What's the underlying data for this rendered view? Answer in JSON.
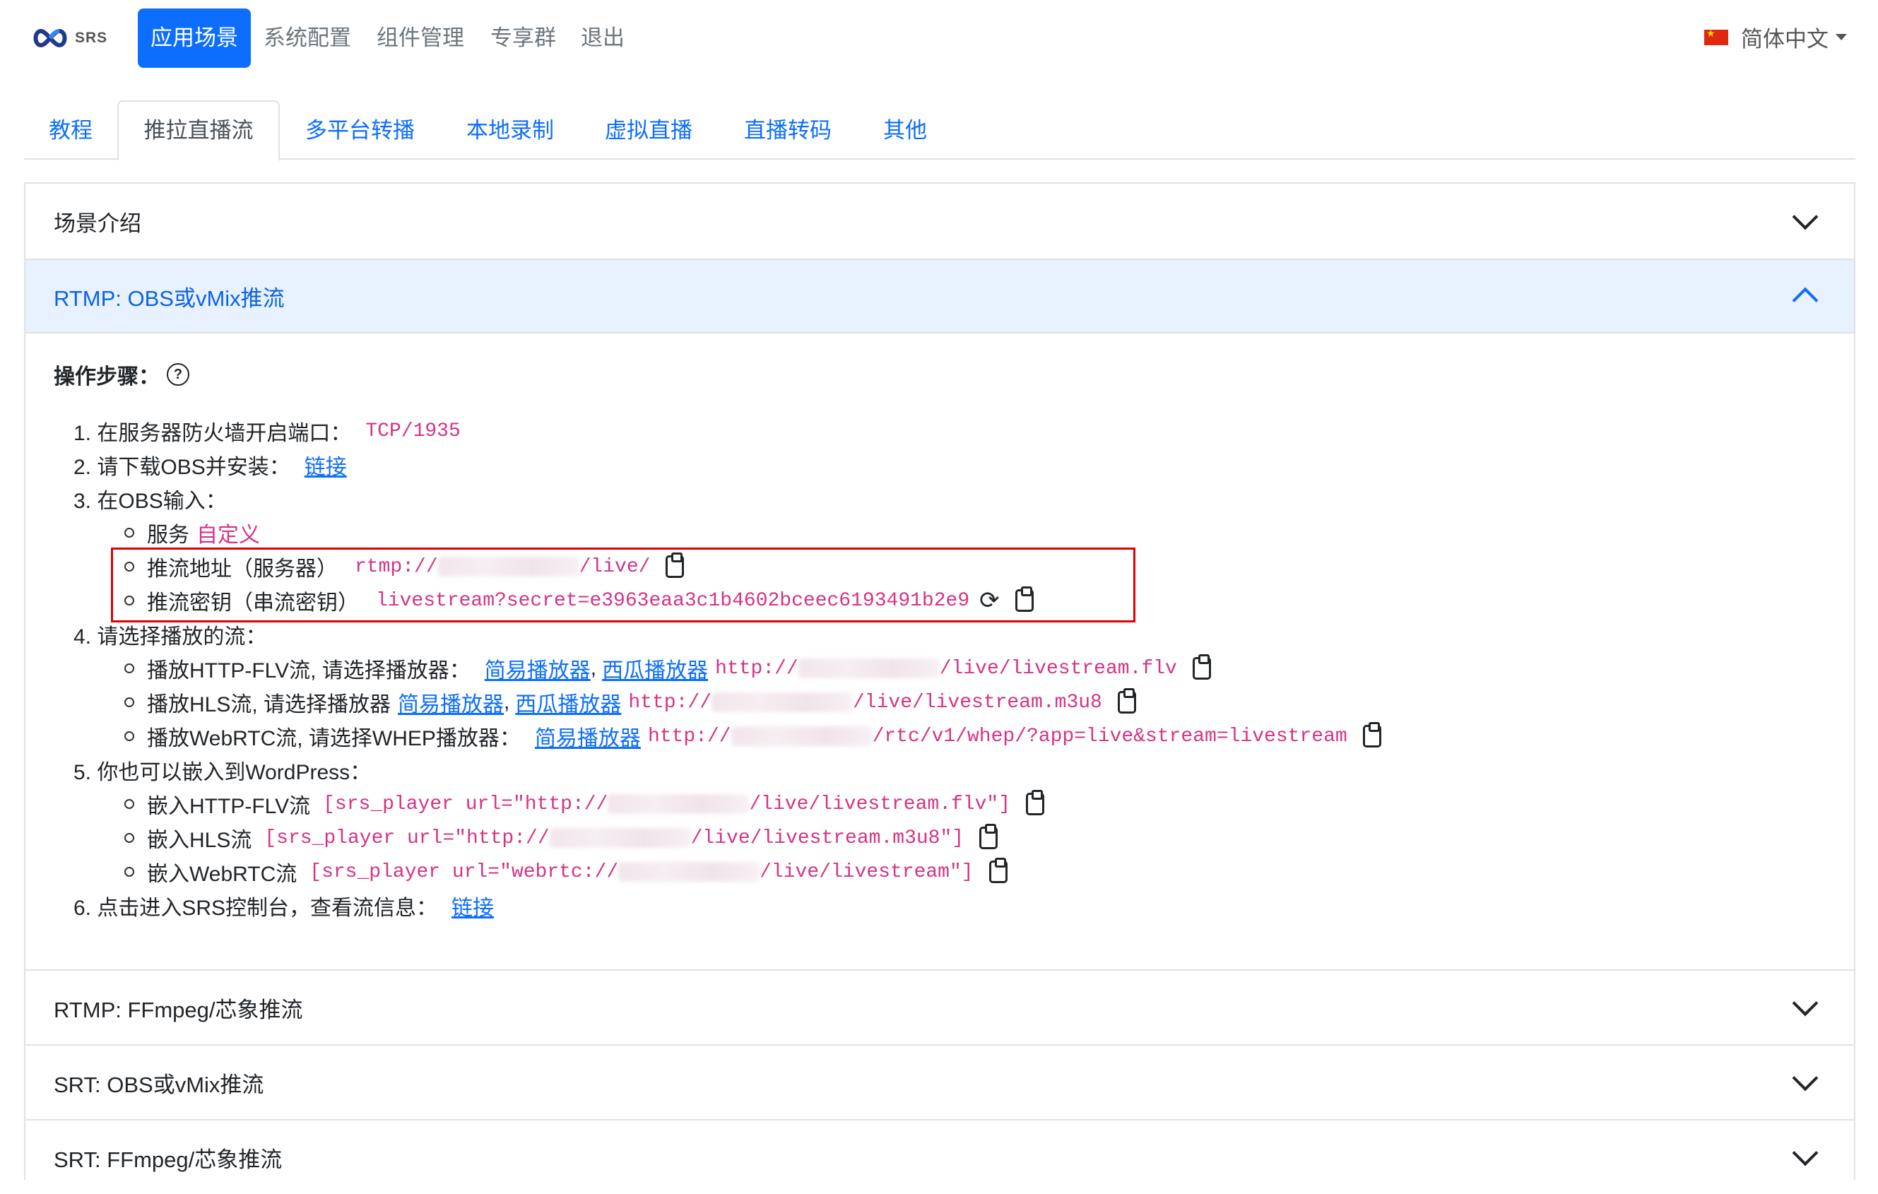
{
  "brand": {
    "logo_text": "SRS"
  },
  "nav": {
    "items": [
      "应用场景",
      "系统配置",
      "组件管理",
      "专享群",
      "退出"
    ],
    "language": "简体中文"
  },
  "tabs": [
    "教程",
    "推拉直播流",
    "多平台转播",
    "本地录制",
    "虚拟直播",
    "直播转码",
    "其他"
  ],
  "accordion": {
    "intro_title": "场景介绍",
    "open_title": "RTMP: OBS或vMix推流",
    "collapsed": [
      "RTMP: FFmpeg/芯象推流",
      "SRT: OBS或vMix推流",
      "SRT: FFmpeg/芯象推流"
    ]
  },
  "steps": {
    "heading": "操作步骤：",
    "help_icon": "?",
    "s1_label": "1. 在服务器防火墙开启端口：",
    "s1_value": "TCP/1935",
    "s2_label": "2. 请下载OBS并安装：",
    "s2_link": "链接",
    "s3_label": "3. 在OBS输入：",
    "s3_service_label": "服务",
    "s3_service_value": "自定义",
    "s3_server_label": "推流地址（服务器）",
    "s3_server_prefix": "rtmp://",
    "s3_server_suffix": "/live/",
    "s3_key_label": "推流密钥（串流密钥）",
    "s3_key_value": "livestream?secret=e3963eaa3c1b4602bceec6193491b2e9",
    "s4_label": "4. 请选择播放的流：",
    "s4_flv_label": "播放HTTP-FLV流, 请选择播放器：",
    "s4_hls_label": "播放HLS流, 请选择播放器",
    "s4_rtc_label": "播放WebRTC流, 请选择WHEP播放器：",
    "player_simple": "简易播放器",
    "player_xigua": "西瓜播放器",
    "comma": ",",
    "http_prefix": "http://",
    "flv_suffix": "/live/livestream.flv",
    "hls_suffix": "/live/livestream.m3u8",
    "rtc_suffix": "/rtc/v1/whep/?app=live&stream=livestream",
    "s5_label": "5. 你也可以嵌入到WordPress：",
    "s5_flv_label": "嵌入HTTP-FLV流",
    "s5_flv_prefix": "[srs_player url=\"http://",
    "s5_flv_suffix": "/live/livestream.flv\"]",
    "s5_hls_label": "嵌入HLS流",
    "s5_hls_prefix": "[srs_player url=\"http://",
    "s5_hls_suffix": "/live/livestream.m3u8\"]",
    "s5_rtc_label": "嵌入WebRTC流",
    "s5_rtc_prefix": "[srs_player url=\"webrtc://",
    "s5_rtc_suffix": "/live/livestream\"]",
    "s6_label": "6. 点击进入SRS控制台，查看流信息：",
    "s6_link": "链接"
  },
  "colors": {
    "primary": "#0d6efd",
    "code": "#d63384",
    "highlight_box": "#e00000",
    "accordion_open_bg": "#e7f1ff"
  }
}
